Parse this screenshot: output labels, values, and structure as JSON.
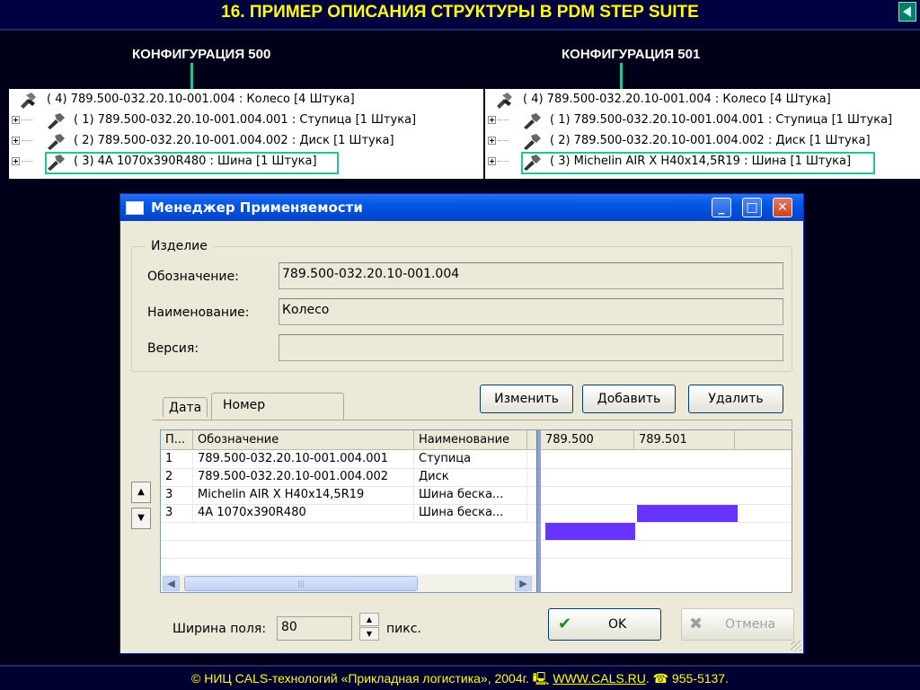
{
  "slide": {
    "title": "16. ПРИМЕР ОПИСАНИЯ СТРУКТУРЫ В PDM STEP SUITE"
  },
  "configs": [
    {
      "label": "КОНФИГУРАЦИЯ 500",
      "root": "( 4) 789.500-032.20.10-001.004 : Колесо [4 Штука]",
      "items": [
        "( 1) 789.500-032.20.10-001.004.001 : Ступица [1 Штука]",
        "( 2) 789.500-032.20.10-001.004.002 : Диск [1 Штука]",
        "( 3) 4А 1070х390R480 : Шина [1 Штука]"
      ]
    },
    {
      "label": "КОНФИГУРАЦИЯ 501",
      "root": "( 4) 789.500-032.20.10-001.004 : Колесо [4 Штука]",
      "items": [
        "( 1) 789.500-032.20.10-001.004.001 : Ступица [1 Штука]",
        "( 2) 789.500-032.20.10-001.004.002 : Диск [1 Штука]",
        "( 3) Michelin AIR X H40x14,5R19 : Шина [1 Штука]"
      ]
    }
  ],
  "dialog": {
    "title": "Менеджер Применяемости",
    "group_label": "Изделие",
    "designation_label": "Обозначение:",
    "designation_value": "789.500-032.20.10-001.004",
    "name_label": "Наименование:",
    "name_value": "Колесо",
    "version_label": "Версия:",
    "version_value": "",
    "tabs": [
      "Дата",
      "Номер"
    ],
    "buttons": {
      "edit": "Изменить",
      "add": "Добавить",
      "delete": "Удалить",
      "ok": "OK",
      "cancel": "Отмена"
    },
    "grid": {
      "headers": [
        "П...",
        "Обозначение",
        "Наименование"
      ],
      "config_headers": [
        "789.500",
        "789.501"
      ],
      "rows": [
        {
          "pos": "1",
          "designation": "789.500-032.20.10-001.004.001",
          "name": "Ступица"
        },
        {
          "pos": "2",
          "designation": "789.500-032.20.10-001.004.002",
          "name": "Диск"
        },
        {
          "pos": "3",
          "designation": "Michelin AIR X H40x14,5R19",
          "name": "Шина беска..."
        },
        {
          "pos": "3",
          "designation": "4А 1070х390R480",
          "name": "Шина беска..."
        }
      ],
      "applicability": [
        {
          "row": 2,
          "config": "789.501"
        },
        {
          "row": 3,
          "config": "789.500"
        }
      ],
      "mark_color": "#6633ff"
    },
    "width_label": "Ширина поля:",
    "width_value": "80",
    "width_unit": "пикс."
  },
  "footer": {
    "prefix": "© НИЦ CALS-технологий «Прикладная логистика», 2004г. 🖳 ",
    "link": "WWW.CALS.RU",
    "phone": ". ☎ 955-5137."
  },
  "colors": {
    "title": "#ffff00",
    "highlight": "#23c29b",
    "background": "#000018"
  }
}
